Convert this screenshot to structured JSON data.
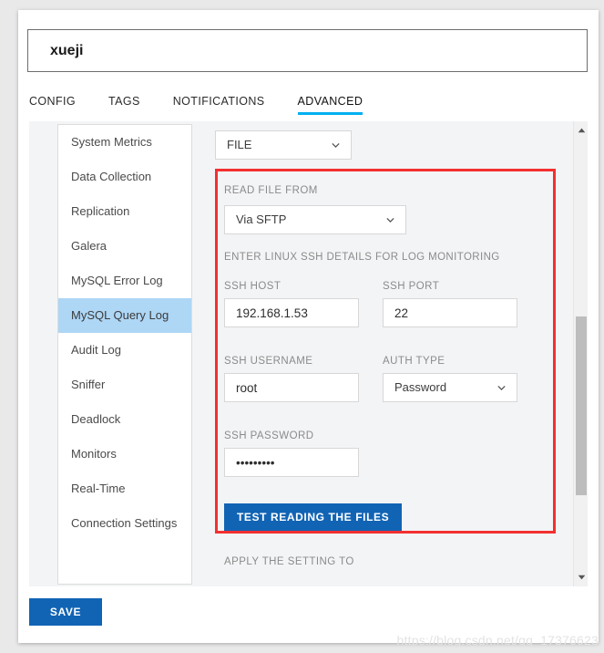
{
  "window": {
    "name_field": {
      "value": "xueji",
      "placeholder": "Name"
    }
  },
  "tabs": [
    {
      "label": "CONFIG",
      "active": false
    },
    {
      "label": "TAGS",
      "active": false
    },
    {
      "label": "NOTIFICATIONS",
      "active": false
    },
    {
      "label": "ADVANCED",
      "active": true
    }
  ],
  "sidebar": {
    "items": [
      {
        "label": "System Metrics",
        "selected": false
      },
      {
        "label": "Data Collection",
        "selected": false
      },
      {
        "label": "Replication",
        "selected": false
      },
      {
        "label": "Galera",
        "selected": false
      },
      {
        "label": "MySQL Error Log",
        "selected": false
      },
      {
        "label": "MySQL Query Log",
        "selected": true
      },
      {
        "label": "Audit Log",
        "selected": false
      },
      {
        "label": "Sniffer",
        "selected": false
      },
      {
        "label": "Deadlock",
        "selected": false
      },
      {
        "label": "Monitors",
        "selected": false
      },
      {
        "label": "Real-Time",
        "selected": false
      },
      {
        "label": "Connection Settings",
        "selected": false
      }
    ]
  },
  "form": {
    "source_select": {
      "value": "FILE"
    },
    "read_file_from": {
      "label": "READ FILE FROM",
      "value": "Via SFTP"
    },
    "ssh_note": "ENTER LINUX SSH DETAILS FOR LOG MONITORING",
    "ssh_host": {
      "label": "SSH HOST",
      "value": "192.168.1.53"
    },
    "ssh_port": {
      "label": "SSH PORT",
      "value": "22"
    },
    "ssh_username": {
      "label": "SSH USERNAME",
      "value": "root"
    },
    "auth_type": {
      "label": "AUTH TYPE",
      "value": "Password"
    },
    "ssh_password": {
      "label": "SSH PASSWORD",
      "value": "•••••••••"
    },
    "test_button": {
      "label": "TEST READING THE FILES"
    },
    "apply_setting_to": {
      "label": "APPLY THE SETTING TO",
      "value": ""
    }
  },
  "footer": {
    "save_label": "SAVE"
  },
  "watermark": "https://blog.csdn.net/qq_17376623",
  "colors": {
    "accent_tab": "#00b0f0",
    "primary_button": "#1164b4",
    "highlight_box": "#f23030",
    "nav_selected": "#aed6f5"
  }
}
